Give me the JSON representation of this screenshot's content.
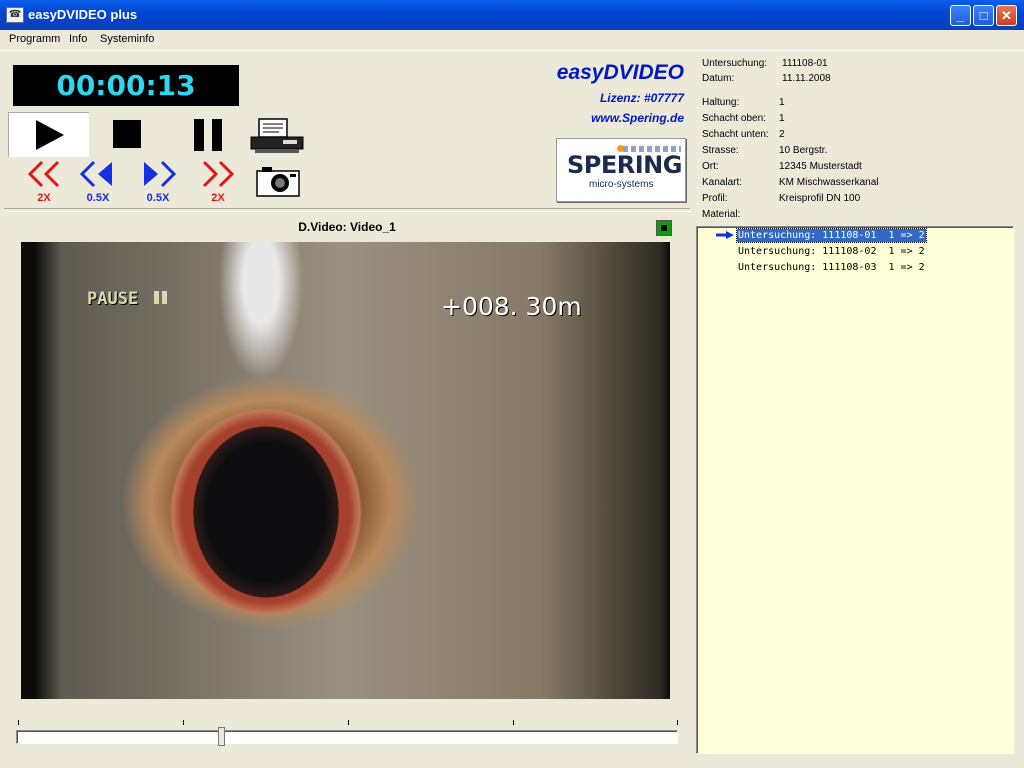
{
  "window": {
    "title": "easyDVIDEO plus",
    "icon": "app-icon"
  },
  "menu": [
    "Programm",
    "Info",
    "Systeminfo"
  ],
  "player": {
    "timer": "00:00:13",
    "rewind_fast": "2X",
    "rewind_slow": "0.5X",
    "forward_slow": "0.5X",
    "forward_fast": "2X"
  },
  "brand": {
    "title": "easyDVIDEO",
    "license": "Lizenz: #07777",
    "website": "www.Spering.de",
    "logo_name": "SPERING",
    "logo_sub": "micro-systems"
  },
  "video": {
    "title": "D.Video: Video_1",
    "overlay_status": "PAUSE",
    "overlay_distance": "+008. 30m"
  },
  "slider": {
    "position_fraction": 0.31
  },
  "info": {
    "untersuchung": {
      "label": "Untersuchung:",
      "value": "111108-01"
    },
    "datum": {
      "label": "Datum:",
      "value": "11.11.2008"
    },
    "haltung": {
      "label": "Haltung:",
      "value": "1"
    },
    "schacht_oben": {
      "label": "Schacht oben:",
      "value": "1"
    },
    "schacht_unten": {
      "label": "Schacht unten:",
      "value": "2"
    },
    "strasse": {
      "label": "Strasse:",
      "value": "10 Bergstr."
    },
    "ort": {
      "label": "Ort:",
      "value": "12345 Musterstadt"
    },
    "kanalart": {
      "label": "Kanalart:",
      "value": "KM Mischwasserkanal"
    },
    "profil": {
      "label": "Profil:",
      "value": "Kreisprofil DN 100"
    },
    "material": {
      "label": "Material:",
      "value": ""
    }
  },
  "list": [
    "Untersuchung: 111108-01  1 => 2",
    "Untersuchung: 111108-02  1 => 2",
    "Untersuchung: 111108-03  1 => 2"
  ],
  "colors": {
    "accent": "#0017c7",
    "timer_text": "#2ed7f0",
    "list_bg": "#ffffd8",
    "selection": "#3168c5"
  }
}
